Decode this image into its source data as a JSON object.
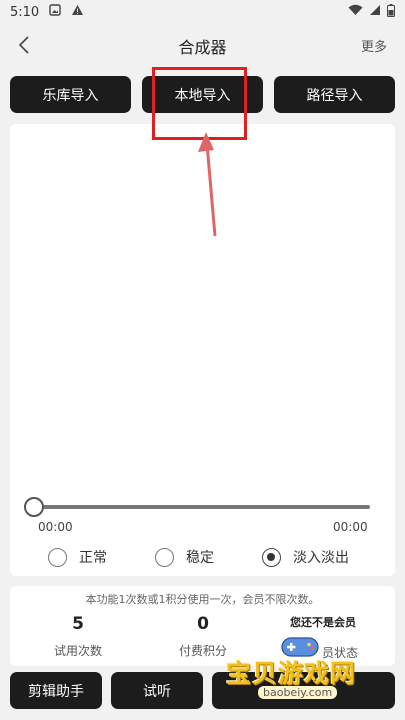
{
  "status_bar": {
    "time": "5:10"
  },
  "header": {
    "title": "合成器",
    "more": "更多"
  },
  "import_buttons": [
    "乐库导入",
    "本地导入",
    "路径导入"
  ],
  "player": {
    "start_time": "00:00",
    "end_time": "00:00",
    "progress": 0
  },
  "fade_options": {
    "items": [
      "正常",
      "稳定",
      "淡入淡出"
    ],
    "selected": "淡入淡出"
  },
  "info": {
    "note": "本功能1次数或1积分使用一次，会员不限次数。",
    "trial_count": "5",
    "trial_label": "试用次数",
    "points": "0",
    "points_label": "付费积分",
    "member_status": "您还不是会员",
    "member_label": "员状态"
  },
  "bottom_buttons": {
    "edit_assistant": "剪辑助手",
    "listen": "试听"
  },
  "watermark": {
    "text": "宝贝游戏网",
    "url": "baobeiy.com"
  },
  "colors": {
    "annotation": "#e02020",
    "button_bg": "#1c1c1c",
    "watermark": "#f0c020"
  }
}
